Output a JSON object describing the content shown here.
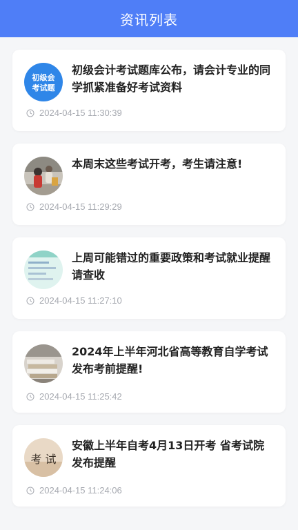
{
  "header": {
    "title": "资讯列表"
  },
  "colors": {
    "header_bg": "#4f7ef7",
    "card_bg": "#ffffff",
    "page_bg": "#f5f6f8",
    "title_text": "#222222",
    "time_text": "#a6a9b0"
  },
  "news": [
    {
      "title": "初级会计考试题库公布，请会计专业的同学抓紧准备好考试资料",
      "time": "2024-04-15 11:30:39",
      "thumb_text": "初级会考试题",
      "thumb_top": "初级会",
      "thumb_bottom": "考试题"
    },
    {
      "title": "本周末这些考试开考，考生请注意!",
      "time": "2024-04-15 11:29:29"
    },
    {
      "title": "上周可能错过的重要政策和考试就业提醒请查收",
      "time": "2024-04-15 11:27:10"
    },
    {
      "title": "2024年上半年河北省高等教育自学考试发布考前提醒!",
      "time": "2024-04-15 11:25:42"
    },
    {
      "title": "安徽上半年自考4月13日开考 省考试院发布提醒",
      "time": "2024-04-15 11:24:06",
      "thumb_text": "考 试"
    }
  ]
}
